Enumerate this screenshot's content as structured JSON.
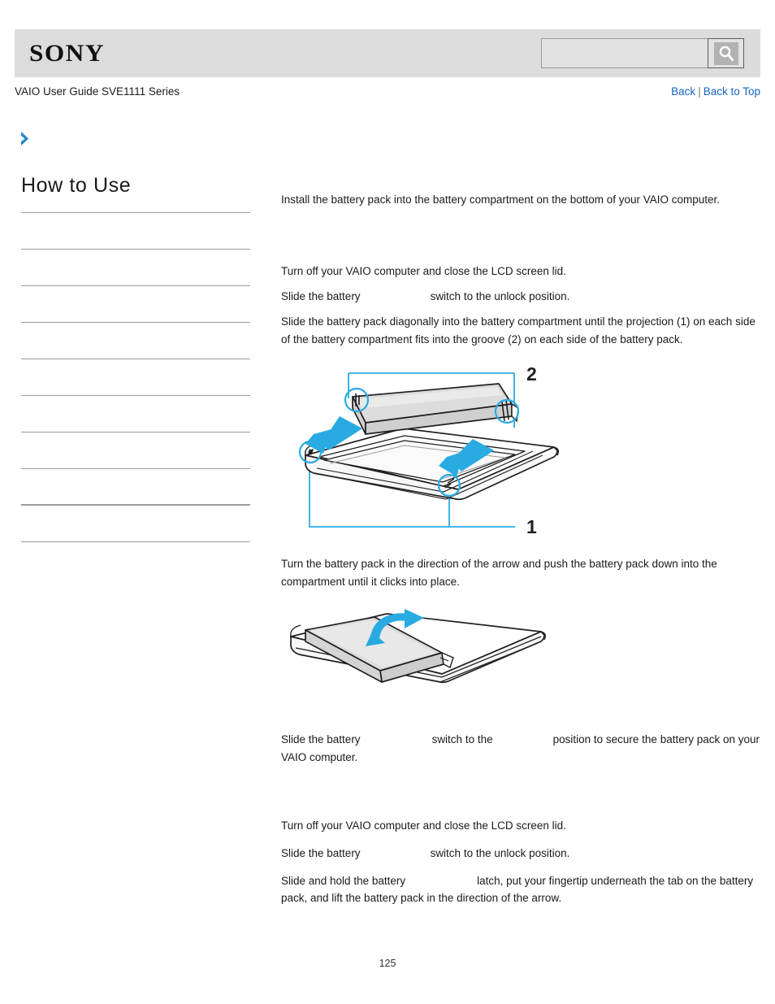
{
  "header": {
    "logo_text": "SONY",
    "search_placeholder": "",
    "search_value": "",
    "search_icon": "magnifier-icon",
    "search_button_label": ""
  },
  "subheader": {
    "guide_title": "VAIO User Guide SVE1111 Series",
    "back_label": "Back",
    "separator": "|",
    "back_to_top_label": "Back to Top"
  },
  "breadcrumb": {
    "chevron_icon": "chevron-right-icon",
    "text": ""
  },
  "sidebar": {
    "title": "How to Use",
    "items": [
      {
        "label": ""
      },
      {
        "label": ""
      },
      {
        "label": ""
      },
      {
        "label": ""
      },
      {
        "label": ""
      },
      {
        "label": ""
      },
      {
        "label": ""
      },
      {
        "label": ""
      },
      {
        "label": ""
      }
    ]
  },
  "content": {
    "intro": "Install the battery pack into the battery compartment on the bottom of your VAIO computer.",
    "install_steps": [
      {
        "parts": [
          {
            "type": "text",
            "value": "Turn off your VAIO computer and close the LCD screen lid."
          }
        ]
      },
      {
        "parts": [
          {
            "type": "text",
            "value": "Slide the battery"
          },
          {
            "type": "image",
            "name": "battery-lock-switch-image",
            "gap": "gap-lock"
          },
          {
            "type": "text",
            "value": "switch to the unlock position."
          }
        ]
      },
      {
        "parts": [
          {
            "type": "text",
            "value": "Slide the battery pack diagonally into the battery compartment until the projection (1) on each side of the battery compartment fits into the groove (2) on each side of the battery pack."
          }
        ]
      }
    ],
    "figure1": {
      "name": "battery-insert-diagram",
      "callout_1": "1",
      "callout_2": "2",
      "alt": "Battery pack sliding diagonally into the battery compartment on the bottom of the VAIO computer"
    },
    "step_turn": "Turn the battery pack in the direction of the arrow and push the battery pack down into the compartment until it clicks into place.",
    "figure2": {
      "name": "battery-rotate-diagram",
      "alt": "Battery pack being turned down into the compartment in the direction of the arrow"
    },
    "step_secure": {
      "parts": [
        {
          "type": "text",
          "value": "Slide the battery"
        },
        {
          "type": "image",
          "name": "battery-lock-switch-image",
          "gap": "gap-lock2"
        },
        {
          "type": "text",
          "value": "switch to the"
        },
        {
          "type": "image",
          "name": "lock-position-image",
          "gap": "gap-pos"
        },
        {
          "type": "text",
          "value": "position to secure the battery pack on your VAIO computer."
        }
      ]
    },
    "removal_steps": [
      {
        "parts": [
          {
            "type": "text",
            "value": "Turn off your VAIO computer and close the LCD screen lid."
          }
        ]
      },
      {
        "parts": [
          {
            "type": "text",
            "value": "Slide the battery"
          },
          {
            "type": "image",
            "name": "battery-lock-switch-image",
            "gap": "gap-lock"
          },
          {
            "type": "text",
            "value": "switch to the unlock position."
          }
        ]
      },
      {
        "parts": [
          {
            "type": "text",
            "value": "Slide and hold the battery"
          },
          {
            "type": "image",
            "name": "battery-release-latch-image",
            "gap": "gap-release"
          },
          {
            "type": "text",
            "value": "latch, put your fingertip underneath the tab on the battery pack, and lift the battery pack in the direction of the arrow."
          }
        ]
      }
    ]
  },
  "footer": {
    "page_number": "125"
  },
  "colors": {
    "header_bg": "#dcdcdc",
    "link_blue": "#1565c0",
    "accent_blue": "#29abe2",
    "rule_gray": "#9b9b9b",
    "illustration_fill": "#dcdcdc"
  }
}
